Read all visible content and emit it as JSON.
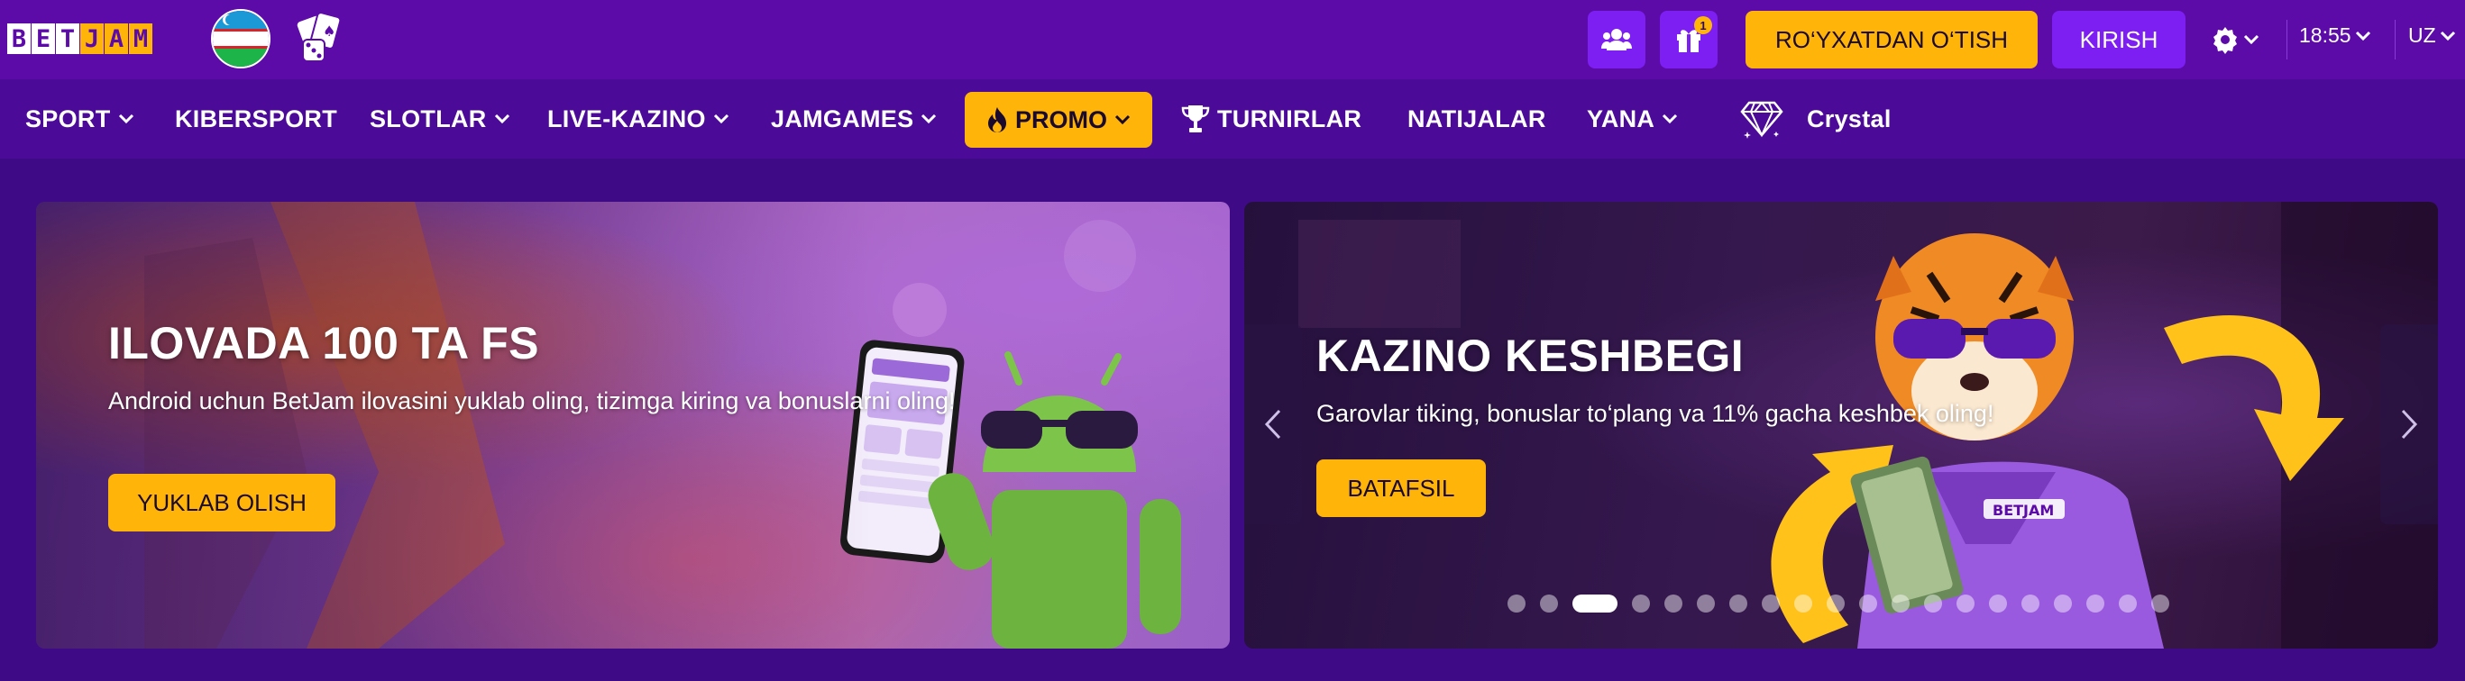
{
  "header": {
    "logo_letters": [
      "B",
      "E",
      "T",
      "J",
      "A",
      "M"
    ],
    "flag_icon": "uzbekistan-flag",
    "register_label": "RO‘YXATDAN O‘TISH",
    "login_label": "KIRISH",
    "gift_badge": "1",
    "time": "18:55",
    "language": "UZ"
  },
  "nav": {
    "items": [
      {
        "label": "SPORT",
        "dropdown": true
      },
      {
        "label": "KIBERSPORT",
        "dropdown": false
      },
      {
        "label": "SLOTLAR",
        "dropdown": true
      },
      {
        "label": "LIVE-KAZINO",
        "dropdown": true
      },
      {
        "label": "JAMGAMES",
        "dropdown": true
      },
      {
        "label": "PROMO",
        "dropdown": true,
        "highlight": true
      },
      {
        "label": "TURNIRLAR",
        "dropdown": false
      },
      {
        "label": "NATIJALAR",
        "dropdown": false
      },
      {
        "label": "YANA",
        "dropdown": true
      },
      {
        "label": "Crystal",
        "dropdown": false
      }
    ]
  },
  "banners": [
    {
      "title": "ILOVADA 100 TA FS",
      "text": "Android uchun BetJam ilovasini yuklab oling, tizimga kiring va bonuslarni oling!",
      "button": "YUKLAB OLISH"
    },
    {
      "title": "KAZINO KESHBEGI",
      "text": "Garovlar tiking, bonuslar to‘plang va 11% gacha keshbek oling!",
      "button": "BATAFSIL"
    }
  ],
  "carousel": {
    "dot_count": 20,
    "active_index": 2
  },
  "colors": {
    "brand_purple": "#5c0aa8",
    "accent_yellow": "#ffb40a",
    "button_purple": "#7d1ef2"
  }
}
